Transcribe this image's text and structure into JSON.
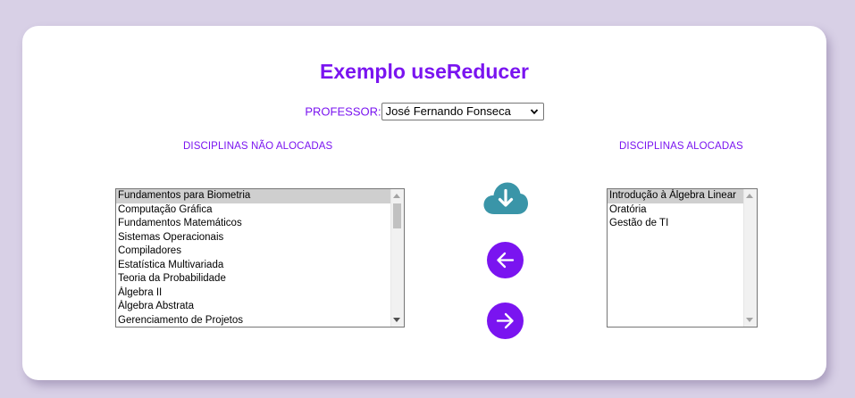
{
  "header": {
    "title": "Exemplo useReducer"
  },
  "professor": {
    "label": "PROFESSOR:",
    "selected": "José Fernando Fonseca"
  },
  "unallocated": {
    "heading": "DISCIPLINAS NÃO ALOCADAS",
    "items": [
      "Fundamentos para Biometria",
      "Computação Gráfica",
      "Fundamentos Matemáticos",
      "Sistemas Operacionais",
      "Compiladores",
      "Estatística Multivariada",
      "Teoria da Probabilidade",
      "Álgebra II",
      "Álgebra Abstrata",
      "Gerenciamento de Projetos"
    ],
    "selected_index": 0
  },
  "allocated": {
    "heading": "DISCIPLINAS ALOCADAS",
    "items": [
      "Introdução à Álgebra Linear",
      "Oratória",
      "Gestão de TI"
    ],
    "selected_index": 0
  },
  "actions": {
    "save_icon": "cloud-download-icon",
    "move_left_icon": "arrow-left-icon",
    "move_right_icon": "arrow-right-icon"
  },
  "colors": {
    "accent": "#7a14f0",
    "cloud": "#3a95a8",
    "background": "#d8d0e6"
  }
}
